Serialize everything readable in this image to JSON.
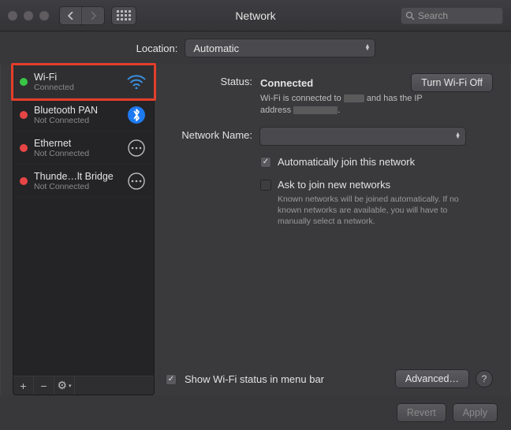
{
  "window": {
    "title": "Network",
    "search_placeholder": "Search",
    "location_label": "Location:",
    "location_value": "Automatic"
  },
  "sidebar": {
    "items": [
      {
        "name": "Wi-Fi",
        "status": "Connected",
        "dot": "green",
        "selected": true,
        "icon": "wifi"
      },
      {
        "name": "Bluetooth PAN",
        "status": "Not Connected",
        "dot": "red",
        "icon": "bluetooth"
      },
      {
        "name": "Ethernet",
        "status": "Not Connected",
        "dot": "red",
        "icon": "ethernet"
      },
      {
        "name": "Thunde…lt Bridge",
        "status": "Not Connected",
        "dot": "red",
        "icon": "thunderbolt"
      }
    ],
    "footer": {
      "add": "+",
      "remove": "−",
      "gear": "⚙︎"
    }
  },
  "panel": {
    "status_label": "Status:",
    "status_value": "Connected",
    "status_sub_pre": "Wi-Fi is connected to",
    "status_sub_mid": "and has the IP address",
    "wifi_toggle": "Turn Wi-Fi Off",
    "network_name_label": "Network Name:",
    "auto_join": "Automatically join this network",
    "ask_join": "Ask to join new networks",
    "ask_help": "Known networks will be joined automatically. If no known networks are available, you will have to manually select a network.",
    "show_status": "Show Wi-Fi status in menu bar",
    "advanced": "Advanced…",
    "help": "?"
  },
  "footer": {
    "revert": "Revert",
    "apply": "Apply"
  }
}
